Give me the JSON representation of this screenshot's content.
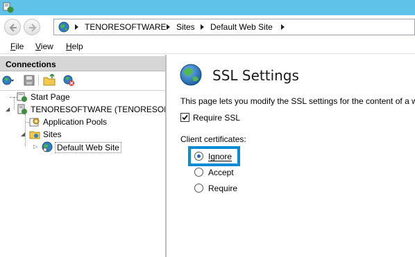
{
  "window": {
    "app_icon": "iis-manager-icon"
  },
  "nav": {
    "back_icon": "back-arrow-icon",
    "forward_icon": "forward-arrow-icon",
    "breadcrumb": [
      "TENORESOFTWARE",
      "Sites",
      "Default Web Site"
    ]
  },
  "menu": {
    "file": "File",
    "view": "View",
    "help": "Help",
    "file_rest": "ile",
    "view_rest": "iew",
    "help_rest": "elp",
    "file_m": "F",
    "view_m": "V",
    "help_m": "H"
  },
  "connections": {
    "title": "Connections",
    "tree": {
      "start_page": "Start Page",
      "server": "TENORESOFTWARE (TENORESOFTW",
      "app_pools": "Application Pools",
      "sites": "Sites",
      "default_site": "Default Web Site"
    }
  },
  "ssl": {
    "title": "SSL Settings",
    "description": "This page lets you modify the SSL settings for the content of a w",
    "require_ssl": {
      "label": "Require SSL",
      "checked": true
    },
    "client_certificates_label": "Client certificates:",
    "options": [
      {
        "label": "Ignore",
        "selected": true
      },
      {
        "label": "Accept",
        "selected": false
      },
      {
        "label": "Require",
        "selected": false
      }
    ]
  },
  "colors": {
    "titlebar": "#5fc2e8",
    "highlight": "#0a8bd6"
  }
}
